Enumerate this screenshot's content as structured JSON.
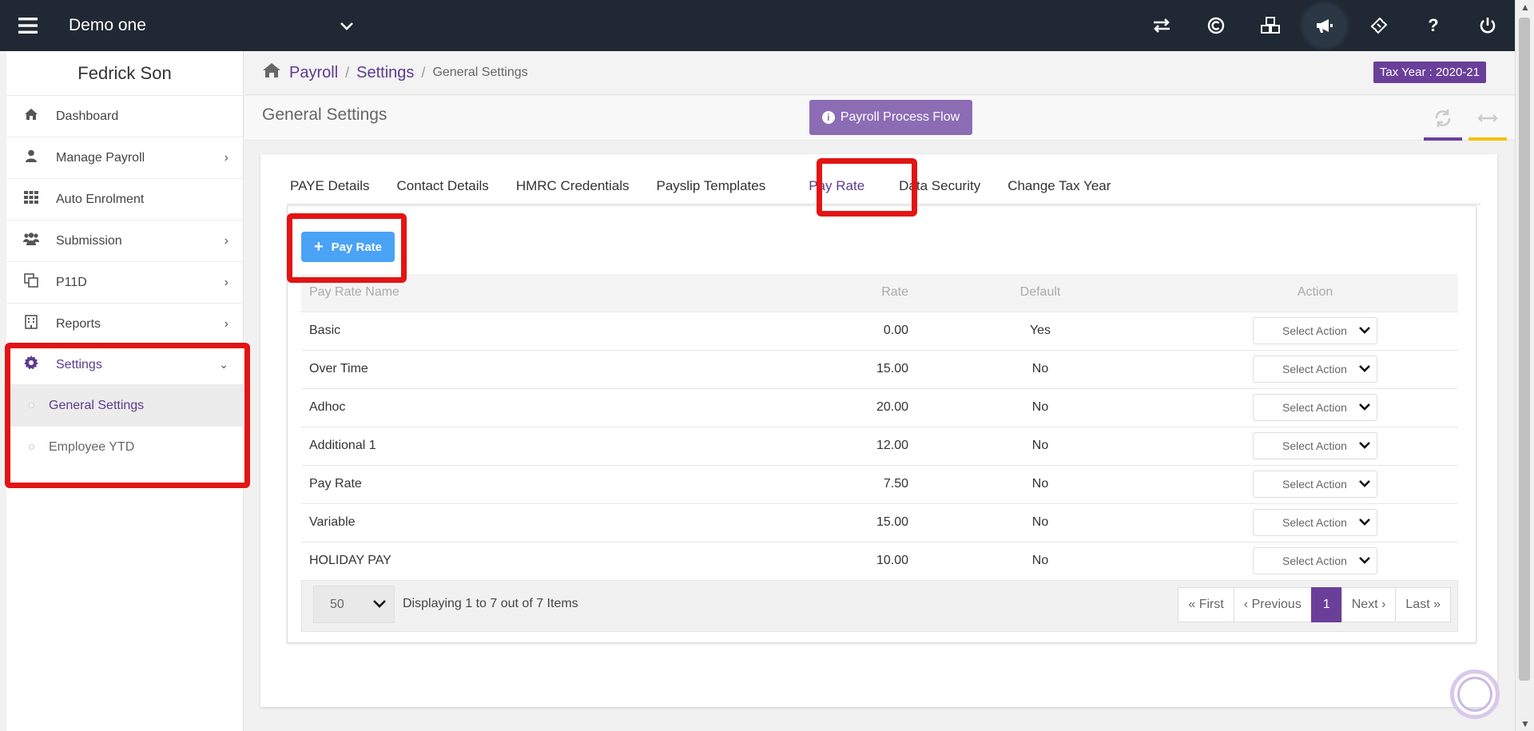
{
  "company": "Demo one",
  "user": "Fedrick Son",
  "tax_year": "Tax Year : 2020-21",
  "breadcrumb": {
    "root": "Payroll",
    "section": "Settings",
    "current": "General Settings"
  },
  "page_title": "General Settings",
  "flow_button": "Payroll Process Flow",
  "nav": {
    "dashboard": "Dashboard",
    "manage_payroll": "Manage Payroll",
    "auto_enrolment": "Auto Enrolment",
    "submission": "Submission",
    "p11d": "P11D",
    "reports": "Reports",
    "settings": "Settings",
    "general_settings": "General Settings",
    "employee_ytd": "Employee YTD"
  },
  "tabs": [
    "PAYE Details",
    "Contact Details",
    "HMRC Credentials",
    "Payslip Templates",
    "Pay Rate",
    "Data Security",
    "Change Tax Year"
  ],
  "add_button": "Pay Rate",
  "table": {
    "headers": {
      "name": "Pay Rate Name",
      "rate": "Rate",
      "default": "Default",
      "action": "Action"
    },
    "rows": [
      {
        "name": "Basic",
        "rate": "0.00",
        "default": "Yes",
        "action": "Select Action"
      },
      {
        "name": "Over Time",
        "rate": "15.00",
        "default": "No",
        "action": "Select Action"
      },
      {
        "name": "Adhoc",
        "rate": "20.00",
        "default": "No",
        "action": "Select Action"
      },
      {
        "name": "Additional 1",
        "rate": "12.00",
        "default": "No",
        "action": "Select Action"
      },
      {
        "name": "Pay Rate",
        "rate": "7.50",
        "default": "No",
        "action": "Select Action"
      },
      {
        "name": "Variable",
        "rate": "15.00",
        "default": "No",
        "action": "Select Action"
      },
      {
        "name": "HOLIDAY PAY",
        "rate": "10.00",
        "default": "No",
        "action": "Select Action"
      }
    ]
  },
  "pager": {
    "page_size": "50",
    "summary": "Displaying 1 to 7 out of 7 Items",
    "first": "« First",
    "previous": "‹ Previous",
    "current": "1",
    "next": "Next ›",
    "last": "Last »"
  },
  "colors": {
    "topbar": "#1f2833",
    "brand_purple": "#6a3f9a",
    "flow_button": "#8c6cb5",
    "add_button": "#4aa3f5",
    "highlight": "#e31414"
  },
  "icons": {
    "menu": "hamburger-icon",
    "switch": "swap-icon",
    "copyright": "copyright-icon",
    "modules": "cubes-icon",
    "announce": "megaphone-icon",
    "ticket": "ticket-icon",
    "help": "question-icon",
    "power": "power-icon"
  }
}
